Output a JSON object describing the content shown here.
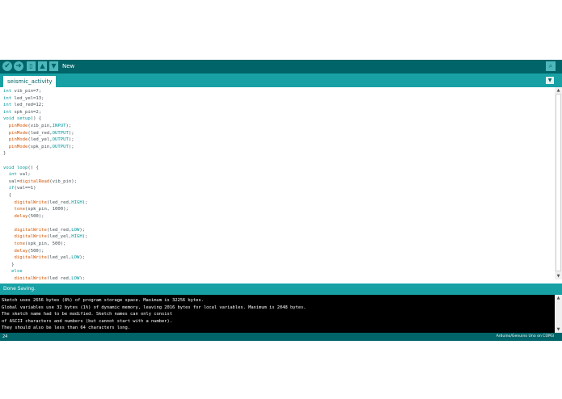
{
  "toolbar": {
    "verify_icon": "check-icon",
    "upload_icon": "arrow-right-icon",
    "new_icon": "file-icon",
    "open_icon": "arrow-up-icon",
    "save_icon": "arrow-down-icon",
    "hover_label": "New",
    "serial_icon": "magnifier-icon"
  },
  "tabs": [
    {
      "label": "seismic_activity",
      "active": true
    }
  ],
  "editor": {
    "code_lines": [
      "int vib_pin=7;",
      "int led_yel=13;",
      "int led_red=12;",
      "int spk_pin=2;",
      "void setup() {",
      "  pinMode(vib_pin,INPUT);",
      "  pinMode(led_red,OUTPUT);",
      "  pinMode(led_yel,OUTPUT);",
      "  pinMode(spk_pin,OUTPUT);",
      "}",
      "",
      "void loop() {",
      "  int val;",
      "  val=digitalRead(vib_pin);",
      "  if(val==1)",
      "  {",
      "    digitalWrite(led_red,HIGH);",
      "    tone(spk_pin, 1000);",
      "    delay(500);",
      "",
      "    digitalWrite(led_red,LOW);",
      "    digitalWrite(led_yel,HIGH);",
      "    tone(spk_pin, 500);",
      "    delay(500);",
      "    digitalWrite(led_yel,LOW);",
      "   }",
      "   else",
      "    digitalWrite(led_red,LOW);"
    ]
  },
  "status": {
    "message": "Done Saving."
  },
  "console": {
    "lines": [
      "Sketch uses 2656 bytes (8%) of program storage space. Maximum is 32256 bytes.",
      "Global variables use 32 bytes (1%) of dynamic memory, leaving 2016 bytes for local variables. Maximum is 2048 bytes.",
      "The sketch name had to be modified. Sketch names can only consist",
      "of ASCII characters and numbers (but cannot start with a number).",
      "They should also be less than 64 characters long."
    ]
  },
  "footer": {
    "line_number": "24",
    "board": "Arduino/Genuino Uno on COM3"
  },
  "colors": {
    "toolbar": "#006468",
    "tabbar": "#17a1a5",
    "keyword": "#00979c",
    "function": "#d35400",
    "console_bg": "#000000"
  }
}
